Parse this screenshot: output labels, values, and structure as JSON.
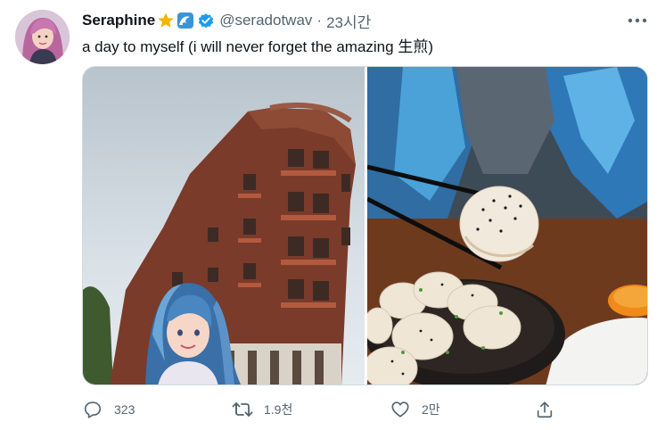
{
  "tweet": {
    "display_name": "Seraphine",
    "name_emojis": [
      "star-emoji",
      "wave-emoji"
    ],
    "handle": "@seradotwav",
    "separator": "·",
    "time": "23시간",
    "text": "a day to myself (i will never forget the amazing 生煎)",
    "media": [
      {
        "name": "building-with-character-photo"
      },
      {
        "name": "soup-dumplings-photo"
      }
    ]
  },
  "actions": {
    "reply_count": "323",
    "retweet_count": "1.9천",
    "like_count": "2만"
  },
  "colors": {
    "text": "#0f1419",
    "muted": "#536471",
    "verified": "#1d9bf0",
    "border": "#cfd9de"
  }
}
